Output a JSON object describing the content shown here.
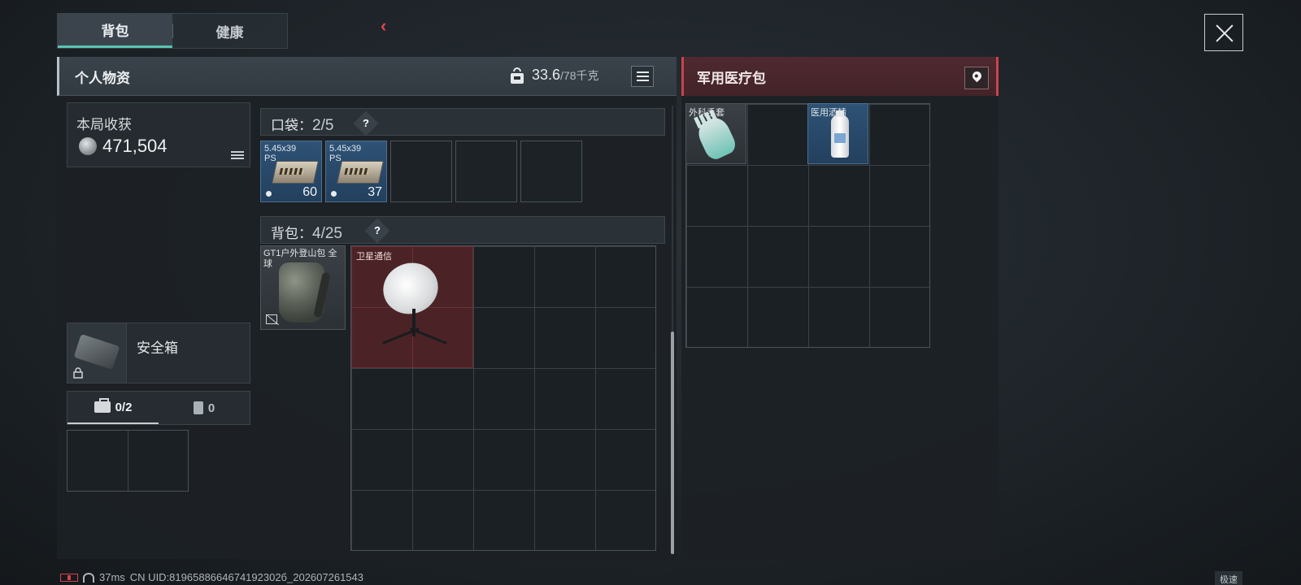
{
  "tabs": [
    {
      "label": "背包",
      "active": true
    },
    {
      "label": "健康",
      "active": false
    }
  ],
  "left_panel": {
    "title": "个人物资",
    "weight": "33.6",
    "weight_capacity": "/78千克"
  },
  "earnings": {
    "title": "本局收获",
    "value": "471,504"
  },
  "safe_box": {
    "label": "安全箱",
    "tabs": [
      {
        "value": "0/2",
        "icon": "medkit-icon"
      },
      {
        "value": "0",
        "icon": "canister-icon"
      }
    ]
  },
  "pockets": {
    "label": "口袋：",
    "count": "2/5",
    "help": "?",
    "items": [
      {
        "label": "5.45x39",
        "sublabel": "PS",
        "count": "60"
      },
      {
        "label": "5.45x39",
        "sublabel": "PS",
        "count": "37"
      }
    ],
    "empty_slots": 3
  },
  "backpack": {
    "label": "背包：",
    "count": "4/25",
    "help": "?",
    "equipped_label": "GT1户外登山包 全球",
    "items": [
      {
        "label": "卫星通信",
        "rarity_color": "#4b2327"
      }
    ]
  },
  "right_panel": {
    "title": "军用医疗包",
    "items": [
      {
        "label": "外科手套"
      },
      {
        "label": "医用酒精"
      }
    ]
  },
  "status_bar": {
    "ping": "37ms",
    "uid": "CN UID:8196588664674192302б_202607261543",
    "mode": "极速"
  },
  "colors": {
    "accent_teal": "#5bc3b3",
    "accent_red": "#c9434d",
    "ammo_blue": "#2e5275"
  }
}
